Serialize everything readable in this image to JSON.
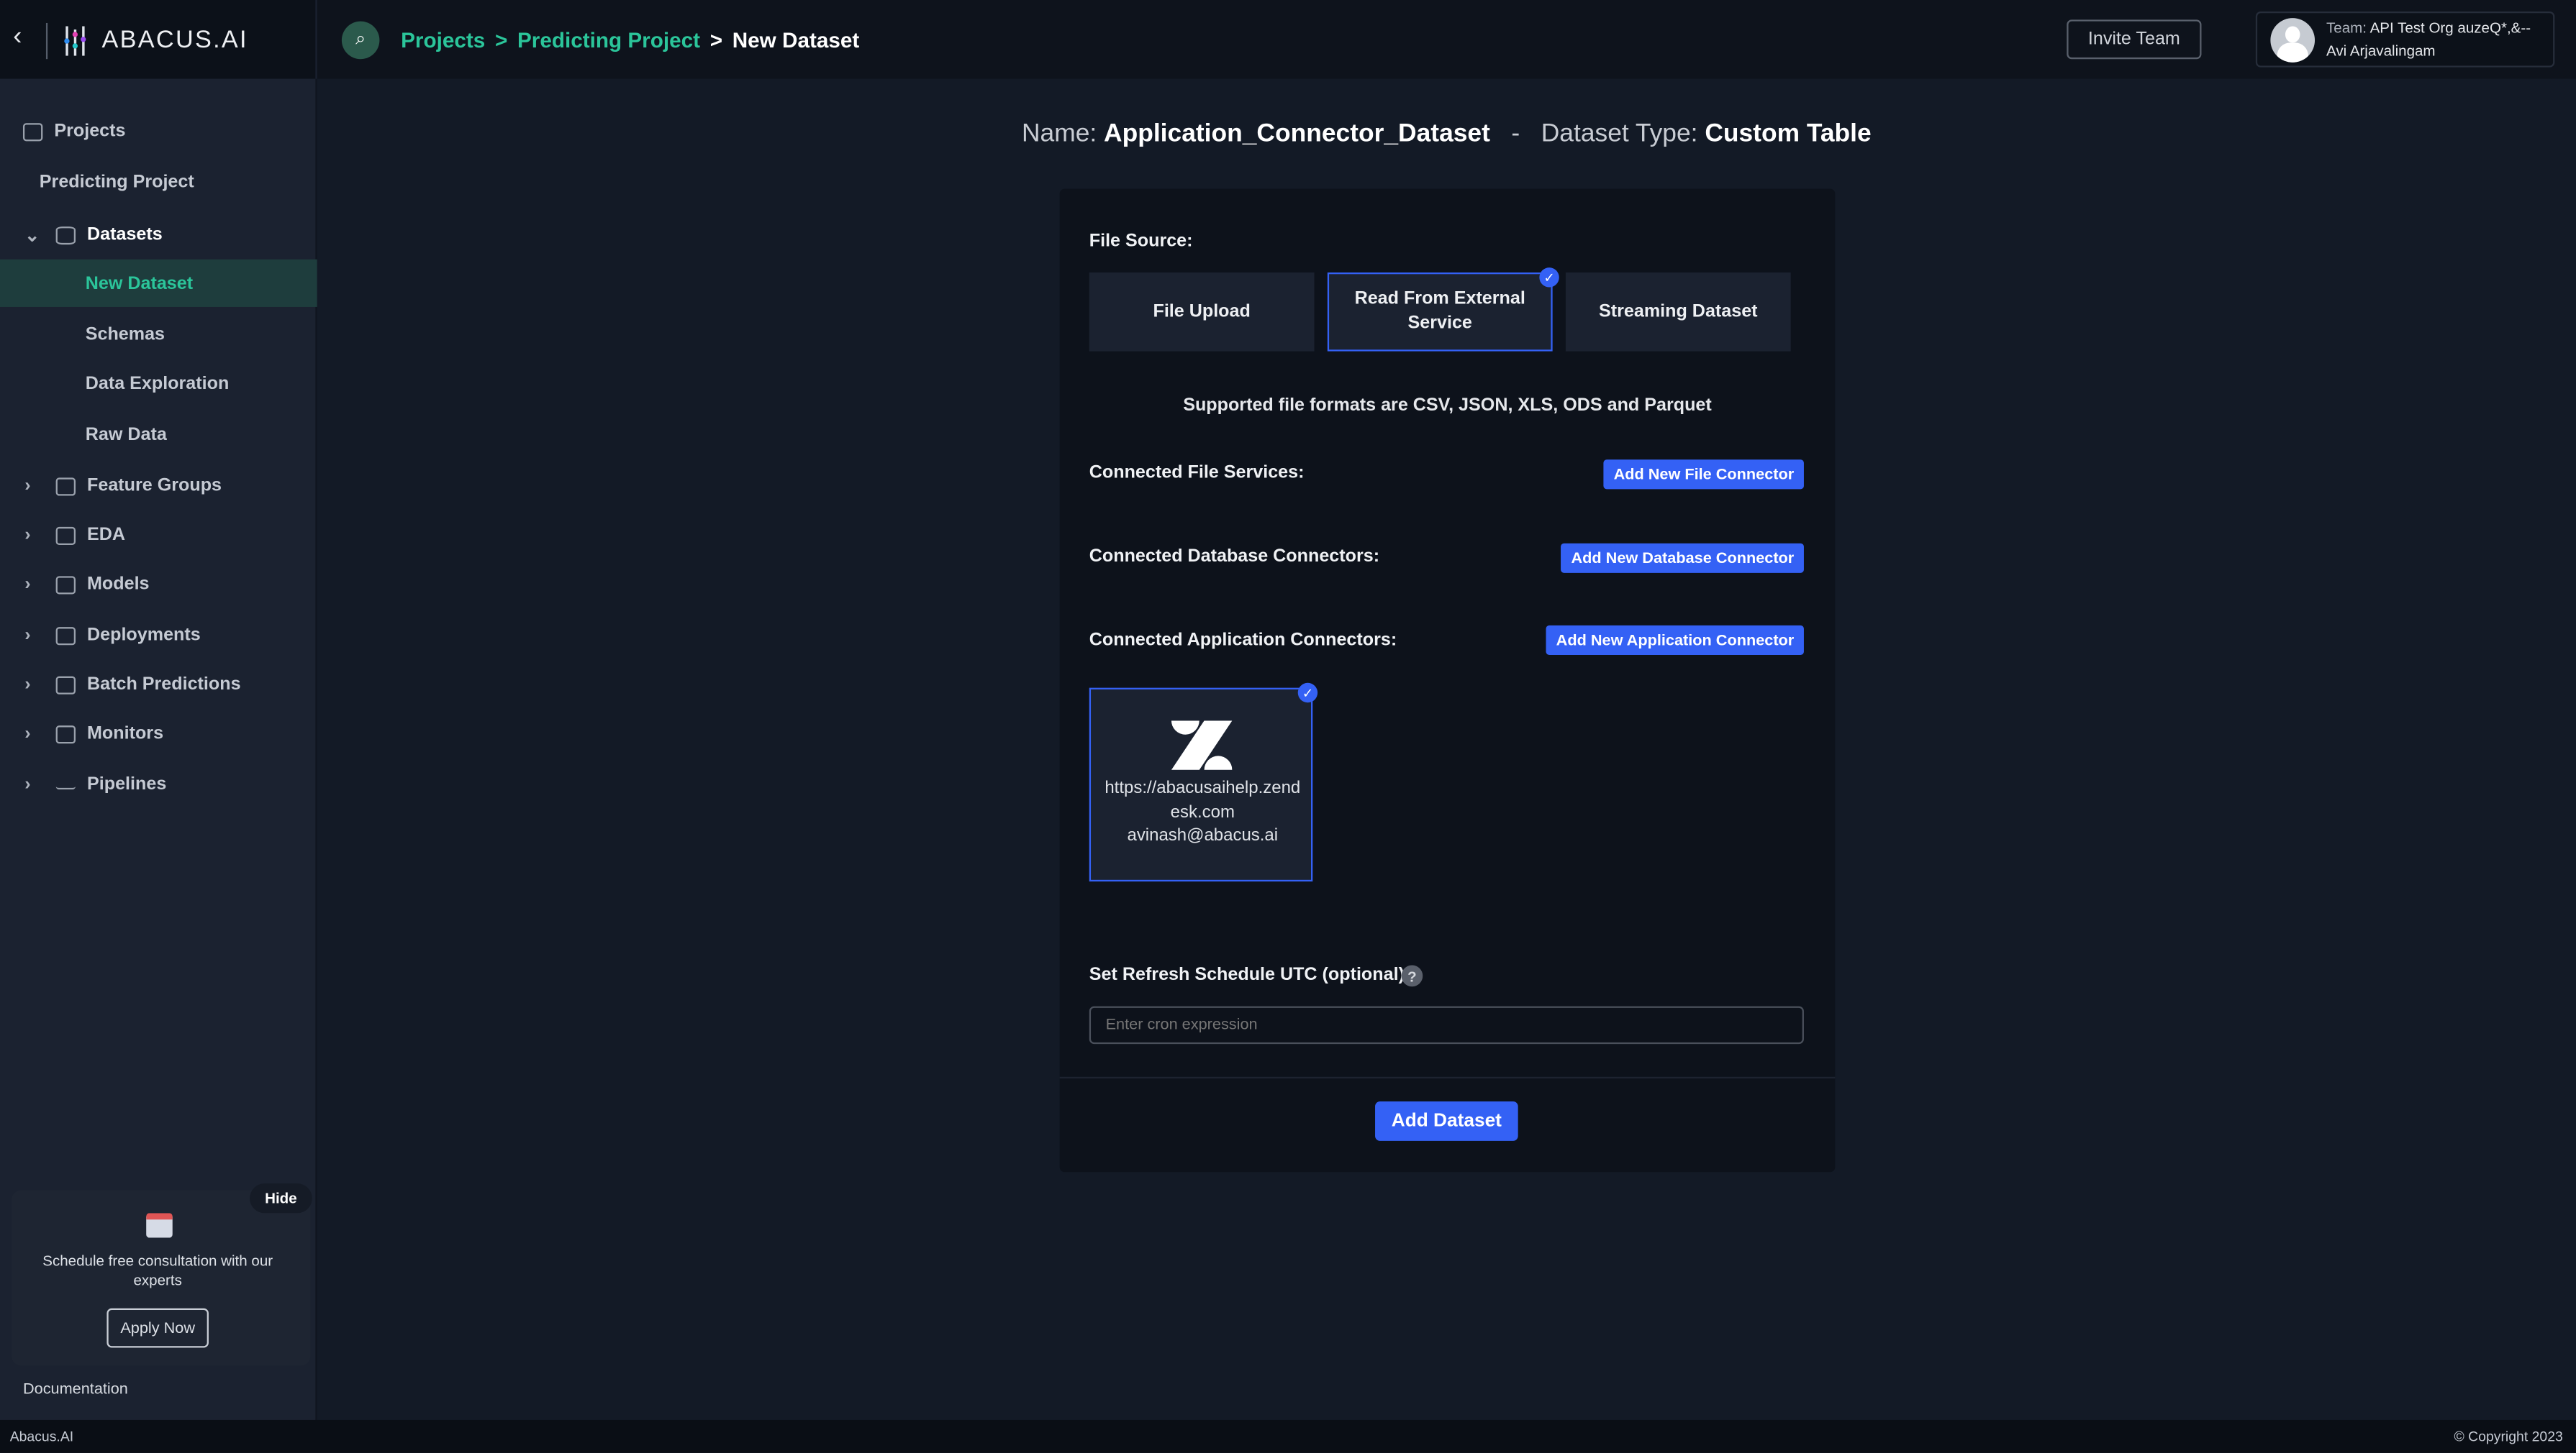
{
  "brand": {
    "name": "ABACUS.AI"
  },
  "breadcrumb": {
    "items": [
      "Projects",
      "Predicting Project",
      "New Dataset"
    ],
    "sep": ">"
  },
  "header": {
    "invite_label": "Invite Team",
    "team_prefix": "Team:",
    "team_name": "API Test Org auzeQ*,&--",
    "user_name": "Avi Arjavalingam"
  },
  "sidebar": {
    "items": [
      {
        "label": "Projects"
      },
      {
        "label": "Predicting Project"
      },
      {
        "label": "Datasets"
      },
      {
        "label": "New Dataset"
      },
      {
        "label": "Schemas"
      },
      {
        "label": "Data Exploration"
      },
      {
        "label": "Raw Data"
      },
      {
        "label": "Feature Groups"
      },
      {
        "label": "EDA"
      },
      {
        "label": "Models"
      },
      {
        "label": "Deployments"
      },
      {
        "label": "Batch Predictions"
      },
      {
        "label": "Monitors"
      },
      {
        "label": "Pipelines"
      }
    ],
    "promo": {
      "hide": "Hide",
      "text": "Schedule free consultation with our experts",
      "apply": "Apply Now"
    },
    "documentation": "Documentation"
  },
  "title": {
    "name_label": "Name:",
    "name": "Application_Connector_Dataset",
    "dash": "-",
    "type_label": "Dataset Type:",
    "type": "Custom Table"
  },
  "form": {
    "file_source_label": "File Source:",
    "sources": [
      "File Upload",
      "Read From External Service",
      "Streaming Dataset"
    ],
    "selected_source": "Read From External Service",
    "supported": "Supported file formats are CSV, JSON, XLS, ODS and Parquet",
    "file_services_label": "Connected File Services:",
    "add_file": "Add New File Connector",
    "db_label": "Connected Database Connectors:",
    "add_db": "Add New Database Connector",
    "app_label": "Connected Application Connectors:",
    "add_app": "Add New Application Connector",
    "connector": {
      "url": "https://abacusaihelp.zendesk.com",
      "email": "avinash@abacus.ai",
      "icon": "zendesk-logo"
    },
    "refresh_label": "Set Refresh Schedule UTC (optional):",
    "help": "?",
    "cron_placeholder": "Enter cron expression",
    "submit": "Add Dataset"
  },
  "footer": {
    "left": "Abacus.AI",
    "right": "© Copyright 2023"
  },
  "colors": {
    "accent": "#3461f5",
    "green": "#2bc59a"
  }
}
